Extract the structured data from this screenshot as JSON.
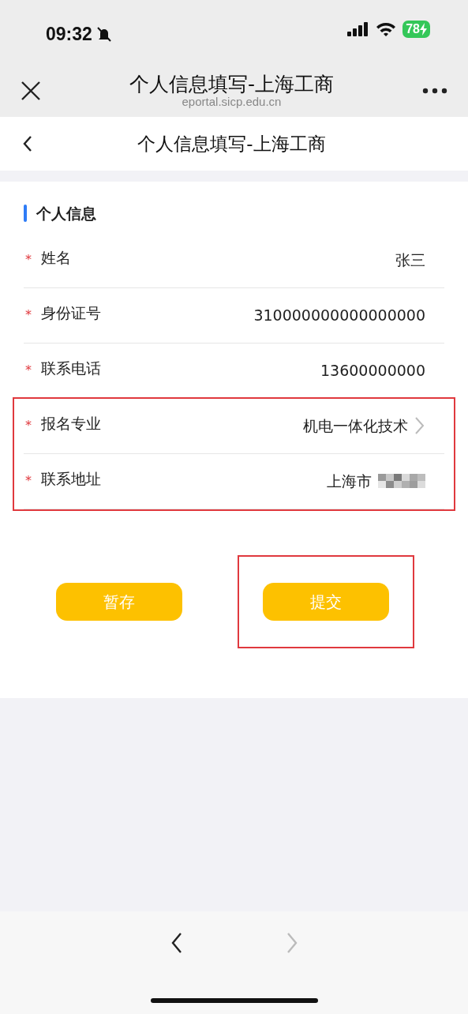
{
  "status_bar": {
    "time": "09:32",
    "muted": true,
    "battery": "78",
    "charging": true
  },
  "browser_header": {
    "title": "个人信息填写-上海工商",
    "url": "eportal.sicp.edu.cn"
  },
  "page_nav": {
    "title": "个人信息填写-上海工商"
  },
  "section": {
    "title": "个人信息"
  },
  "fields": [
    {
      "label": "姓名",
      "value": "张三",
      "required": "*",
      "kind": "text",
      "highlighted": false
    },
    {
      "label": "身份证号",
      "value": "310000000000000000",
      "required": "*",
      "kind": "text",
      "highlighted": false
    },
    {
      "label": "联系电话",
      "value": "13600000000",
      "required": "*",
      "kind": "text",
      "highlighted": false
    },
    {
      "label": "报名专业",
      "value": "机电一体化技术",
      "required": "*",
      "kind": "select",
      "highlighted": true
    },
    {
      "label": "联系地址",
      "value": "上海市",
      "required": "*",
      "kind": "text",
      "redacted": true,
      "highlighted": true
    }
  ],
  "buttons": [
    {
      "label": "暂存",
      "highlighted": false
    },
    {
      "label": "提交",
      "highlighted": true
    }
  ],
  "toolbar": {
    "back_enabled": true,
    "forward_enabled": false
  }
}
